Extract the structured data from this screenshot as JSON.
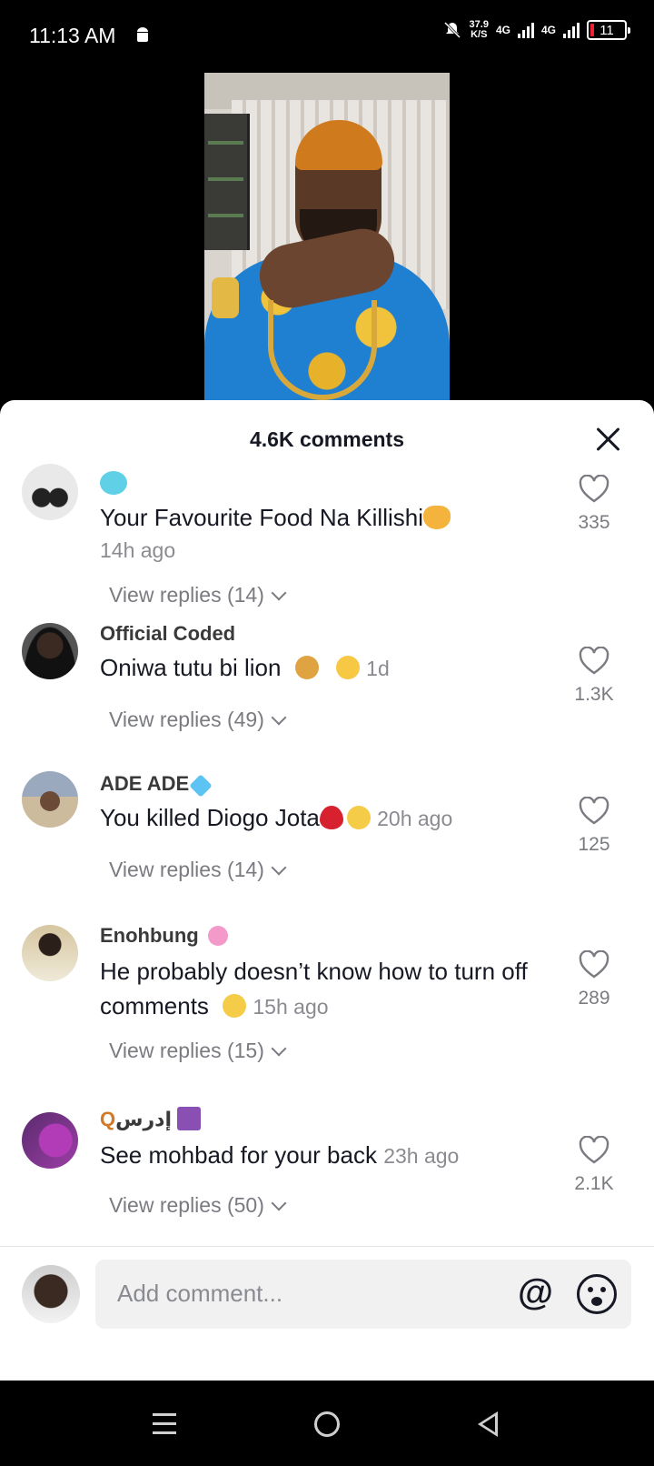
{
  "status_bar": {
    "time": "11:13 AM",
    "net_speed": "37.9",
    "net_unit": "K/S",
    "network_1": "4G",
    "network_2": "4G",
    "battery": "11"
  },
  "sheet": {
    "title": "4.6K comments",
    "close_icon": "close-icon"
  },
  "comments": [
    {
      "username": "",
      "username_emoji": "grimace",
      "text": "Your Favourite Food Na Killishi",
      "text_emoji": "handshake",
      "time": "14h ago",
      "replies": "View replies (14)",
      "likes": "335"
    },
    {
      "username": "Official Coded",
      "text": "Oniwa tutu bi lion",
      "text_emoji": "lion weary",
      "time": "1d",
      "replies": "View replies (49)",
      "likes": "1.3K"
    },
    {
      "username": "ADE ADE",
      "username_emoji": "gem",
      "text": "You killed Diogo Jota",
      "text_emoji": "broken-heart sad",
      "time": "20h ago",
      "replies": "View replies (14)",
      "likes": "125"
    },
    {
      "username": "Enohbung",
      "username_emoji": "flower",
      "text": "He probably doesn’t know how to turn off comments",
      "text_emoji": "crying",
      "time": "15h ago",
      "replies": "View replies (15)",
      "likes": "289"
    },
    {
      "username": "إدرس",
      "username_emoji": "magnifier",
      "text": "See mohbad for your back",
      "time": "23h ago",
      "replies": "View replies (50)",
      "likes": "2.1K"
    }
  ],
  "input": {
    "placeholder": "Add comment...",
    "at_label": "@"
  },
  "colors": {
    "sheet_bg": "#ffffff",
    "text_primary": "#161823",
    "text_secondary": "#8a8b91",
    "input_bg": "#f1f1f2"
  }
}
